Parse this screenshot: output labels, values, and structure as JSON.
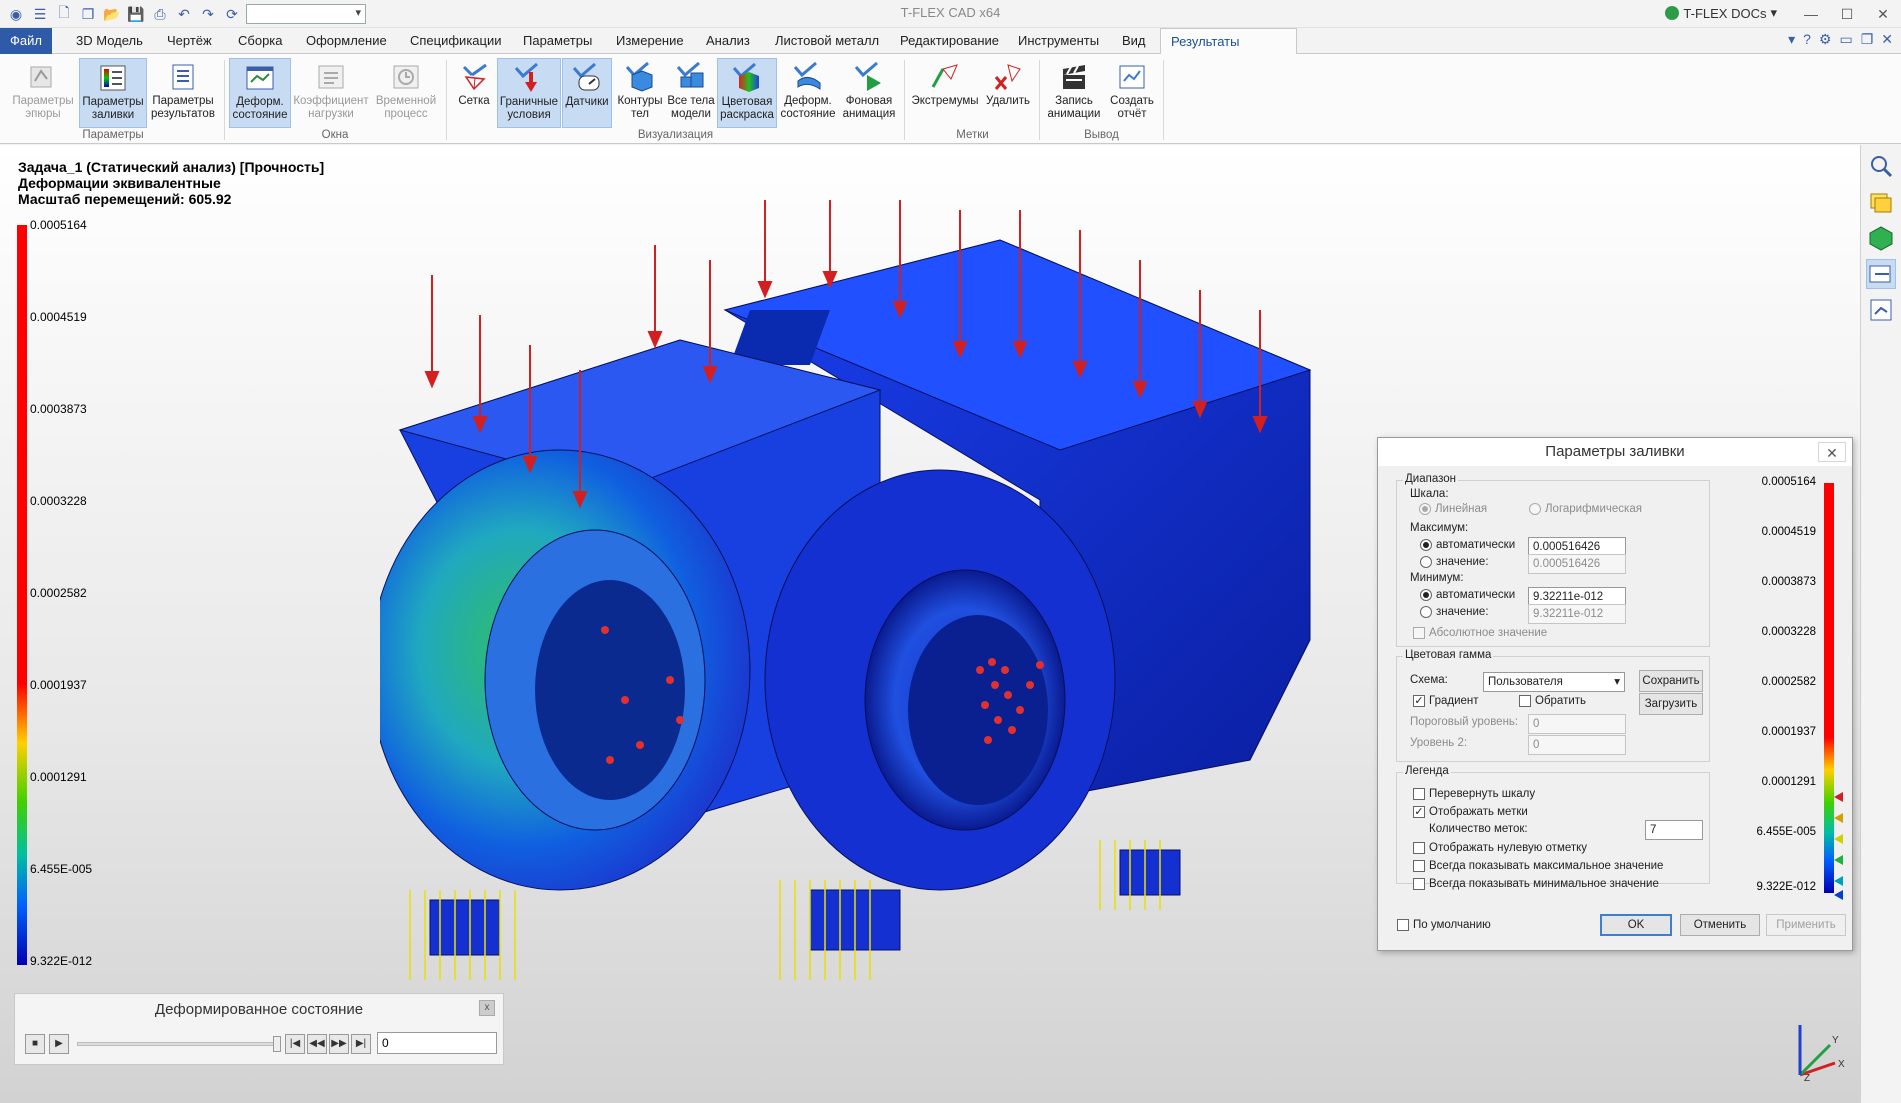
{
  "titlebar": {
    "app_title": "T-FLEX CAD x64",
    "brand": "T-FLEX DOCs",
    "brand_caret": "▾"
  },
  "menu": {
    "file": "Файл",
    "items": [
      "3D Модель",
      "Чертёж",
      "Сборка",
      "Оформление",
      "Спецификации",
      "Параметры",
      "Измерение",
      "Анализ",
      "Листовой металл",
      "Редактирование",
      "Инструменты",
      "Вид",
      "Результаты анализа"
    ]
  },
  "ribbon": {
    "buttons": [
      {
        "label1": "Параметры",
        "label2": "эпюры"
      },
      {
        "label1": "Параметры",
        "label2": "заливки"
      },
      {
        "label1": "Параметры",
        "label2": "результатов"
      },
      {
        "label1": "Деформ.",
        "label2": "состояние"
      },
      {
        "label1": "Коэффициент",
        "label2": "нагрузки"
      },
      {
        "label1": "Временной",
        "label2": "процесс"
      },
      {
        "label1": "Сетка",
        "label2": ""
      },
      {
        "label1": "Граничные",
        "label2": "условия"
      },
      {
        "label1": "Датчики",
        "label2": ""
      },
      {
        "label1": "Контуры",
        "label2": "тел"
      },
      {
        "label1": "Все тела",
        "label2": "модели"
      },
      {
        "label1": "Цветовая",
        "label2": "раскраска"
      },
      {
        "label1": "Деформ.",
        "label2": "состояние"
      },
      {
        "label1": "Фоновая",
        "label2": "анимация"
      },
      {
        "label1": "Экстремумы",
        "label2": ""
      },
      {
        "label1": "Удалить",
        "label2": ""
      },
      {
        "label1": "Запись",
        "label2": "анимации"
      },
      {
        "label1": "Создать",
        "label2": "отчёт"
      }
    ],
    "groups": [
      "Параметры",
      "Окна",
      "Визуализация",
      "Метки",
      "Вывод"
    ]
  },
  "viewport": {
    "info_line1": "Задача_1 (Статический анализ) [Прочность]",
    "info_line2": "Деформации эквивалентные",
    "info_line3": "Масштаб перемещений: 605.92",
    "legend_ticks": [
      "0.0005164",
      "0.0004519",
      "0.0003873",
      "0.0003228",
      "0.0002582",
      "0.0001937",
      "0.0001291",
      "6.455E-005",
      "9.322E-012"
    ]
  },
  "anim_panel": {
    "title": "Деформированное состояние",
    "close": "x",
    "value": "0",
    "position": 1.0
  },
  "dialog": {
    "title": "Параметры заливки",
    "close": "✕",
    "range_group": "Диапазон",
    "scale_label": "Шкала:",
    "linear": "Линейная",
    "log": "Логарифмическая",
    "max_label": "Максимум:",
    "max_auto": "автоматически",
    "max_auto_value": "0.000516426",
    "max_value_label": "значение:",
    "max_value_value": "0.000516426",
    "min_label": "Минимум:",
    "min_auto": "автоматически",
    "min_auto_value": "9.32211e-012",
    "min_value_label": "значение:",
    "min_value_value": "9.32211e-012",
    "abs_value": "Абсолютное значение",
    "color_group": "Цветовая гамма",
    "scheme_label": "Схема:",
    "scheme_value": "Пользователя",
    "save_btn": "Сохранить",
    "load_btn": "Загрузить",
    "gradient": "Градиент",
    "invert": "Обратить",
    "threshold_label": "Пороговый уровень:",
    "threshold_value": "0",
    "level2_label": "Уровень 2:",
    "level2_value": "0",
    "legend_group": "Легенда",
    "flip_scale": "Перевернуть шкалу",
    "show_marks": "Отображать метки",
    "marks_count_label": "Количество меток:",
    "marks_count_value": "7",
    "show_zero": "Отображать нулевую отметку",
    "always_max": "Всегда показывать максимальное значение",
    "always_min": "Всегда показывать минимальное значение",
    "default": "По умолчанию",
    "ok": "OK",
    "cancel": "Отменить",
    "apply": "Применить",
    "legend_ticks": [
      "0.0005164",
      "0.0004519",
      "0.0003873",
      "0.0003228",
      "0.0002582",
      "0.0001937",
      "0.0001291",
      "6.455E-005",
      "9.322E-012"
    ]
  },
  "triad": {
    "x": "X",
    "y": "Y",
    "z": "Z"
  },
  "colors": {
    "accent": "#2f5aa8",
    "selected": "#c7dbf3",
    "force_arrow": "#d22020"
  }
}
